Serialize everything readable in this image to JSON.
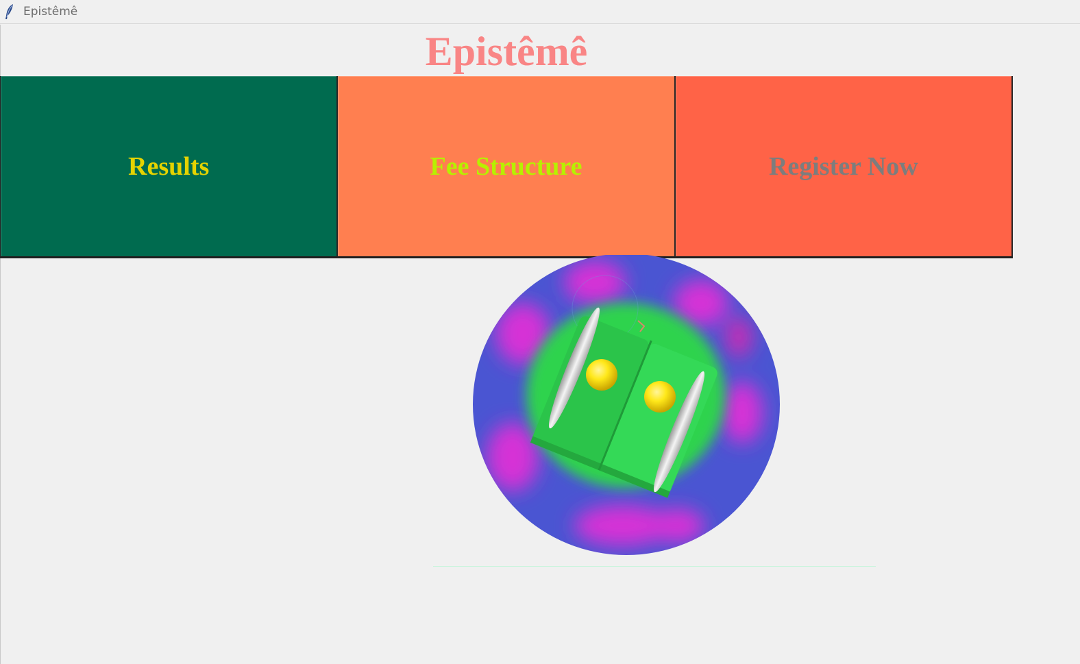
{
  "window": {
    "title": "Epistêmê",
    "icon": "feather-icon"
  },
  "header": {
    "title": "Epistêmê"
  },
  "nav": {
    "buttons": [
      {
        "label": "Results",
        "bg": "#006b4f",
        "fg": "#e5d300"
      },
      {
        "label": "Fee Structure",
        "bg": "#ff7f50",
        "fg": "#b7f000"
      },
      {
        "label": "Register Now",
        "bg": "#ff6347",
        "fg": "#7d7d7d"
      }
    ]
  },
  "logo": {
    "icon": "open-book-logo-icon",
    "colors": {
      "ring": "#4a55d2",
      "glow": "#d633d6",
      "book": "#2ecc50",
      "dots": "#ffe21a"
    }
  }
}
